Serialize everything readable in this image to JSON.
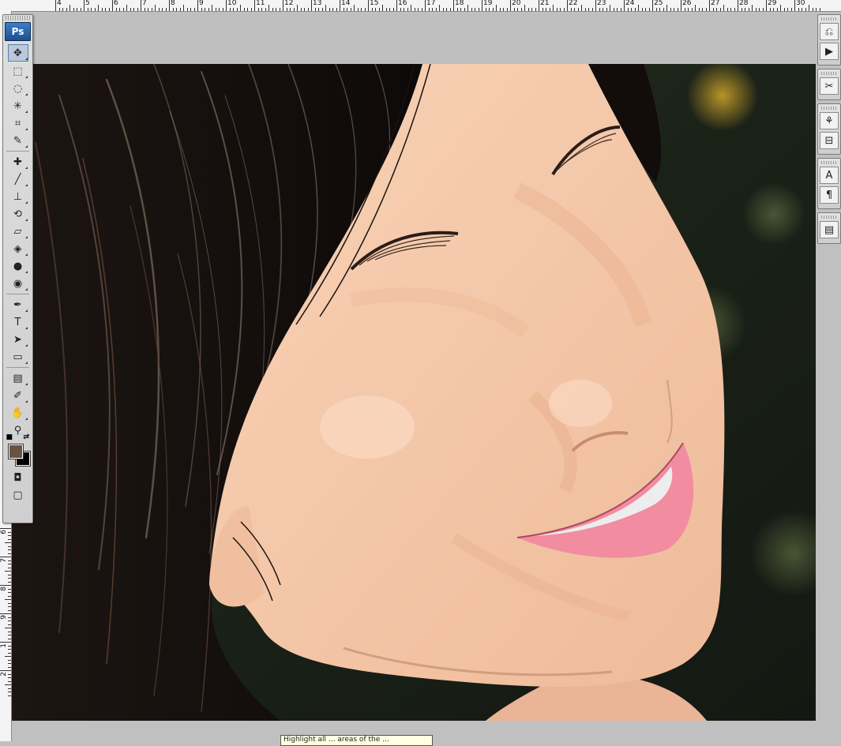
{
  "app": {
    "logo_text": "Ps"
  },
  "rulers": {
    "top_labels": [
      "4",
      "5",
      "6",
      "7",
      "8",
      "9",
      "10",
      "11",
      "12",
      "13",
      "14",
      "15",
      "16",
      "17",
      "18",
      "19",
      "20",
      "21",
      "22",
      "23",
      "24",
      "25",
      "26",
      "27",
      "28",
      "29",
      "30"
    ],
    "left_labels": [
      "6",
      "7",
      "8",
      "9",
      "1",
      "2"
    ]
  },
  "toolbox": {
    "tools": [
      {
        "name": "move-tool",
        "icon": "move-icon",
        "glyph": "✥",
        "active": true
      },
      {
        "name": "marquee-tool",
        "icon": "marquee-icon",
        "glyph": "⬚"
      },
      {
        "name": "lasso-tool",
        "icon": "lasso-icon",
        "glyph": "◌"
      },
      {
        "name": "magic-wand-tool",
        "icon": "magic-wand-icon",
        "glyph": "✳"
      },
      {
        "name": "crop-tool",
        "icon": "crop-icon",
        "glyph": "⌗"
      },
      {
        "name": "eyedropper-tool",
        "icon": "eyedropper-icon",
        "glyph": "✎"
      },
      {
        "sep": true
      },
      {
        "name": "healing-brush-tool",
        "icon": "bandage-icon",
        "glyph": "✚"
      },
      {
        "name": "brush-tool",
        "icon": "brush-icon",
        "glyph": "╱"
      },
      {
        "name": "clone-stamp-tool",
        "icon": "stamp-icon",
        "glyph": "⊥"
      },
      {
        "name": "history-brush-tool",
        "icon": "history-brush-icon",
        "glyph": "⟲"
      },
      {
        "name": "eraser-tool",
        "icon": "eraser-icon",
        "glyph": "▱"
      },
      {
        "name": "paint-bucket-tool",
        "icon": "paint-bucket-icon",
        "glyph": "◈"
      },
      {
        "name": "blur-tool",
        "icon": "blur-drop-icon",
        "glyph": "●"
      },
      {
        "name": "dodge-tool",
        "icon": "dodge-icon",
        "glyph": "◉"
      },
      {
        "sep": true
      },
      {
        "name": "pen-tool",
        "icon": "pen-icon",
        "glyph": "✒"
      },
      {
        "name": "type-tool",
        "icon": "type-icon",
        "glyph": "T"
      },
      {
        "name": "path-selection-tool",
        "icon": "arrow-pointer-icon",
        "glyph": "➤"
      },
      {
        "name": "shape-tool",
        "icon": "rectangle-shape-icon",
        "glyph": "▭"
      },
      {
        "sep": true
      },
      {
        "name": "notes-tool",
        "icon": "notes-icon",
        "glyph": "▤"
      },
      {
        "name": "color-sampler-tool",
        "icon": "eyedropper-icon",
        "glyph": "✐"
      },
      {
        "name": "hand-tool",
        "icon": "hand-icon",
        "glyph": "✋"
      },
      {
        "name": "zoom-tool",
        "icon": "magnifier-icon",
        "glyph": "⚲"
      }
    ],
    "foreground_color": "#6b5240",
    "background_color": "#000000",
    "mode_tools": [
      {
        "name": "quick-mask-button",
        "icon": "quick-mask-icon",
        "glyph": "◘"
      },
      {
        "name": "screen-mode-button",
        "icon": "screen-mode-icon",
        "glyph": "▢"
      }
    ]
  },
  "panel_dock": {
    "groups": [
      [
        "history-icon",
        "actions-play-icon"
      ],
      [
        "tool-presets-icon"
      ],
      [
        "brushes-icon",
        "clone-source-icon"
      ],
      [
        "character-icon",
        "paragraph-icon"
      ],
      [
        "layer-comps-icon"
      ]
    ],
    "glyphs": {
      "history-icon": "⎌",
      "actions-play-icon": "▶",
      "tool-presets-icon": "✂",
      "brushes-icon": "⚘",
      "clone-source-icon": "⊟",
      "character-icon": "A",
      "paragraph-icon": "¶",
      "layer-comps-icon": "▤"
    }
  },
  "tooltip": {
    "text": "Highlight all ... areas of the ..."
  },
  "colors": {
    "workspace": "#c0c0c0",
    "skin": "#f5c6a6",
    "hair": "#140f0d",
    "lips": "#f28ca0"
  }
}
